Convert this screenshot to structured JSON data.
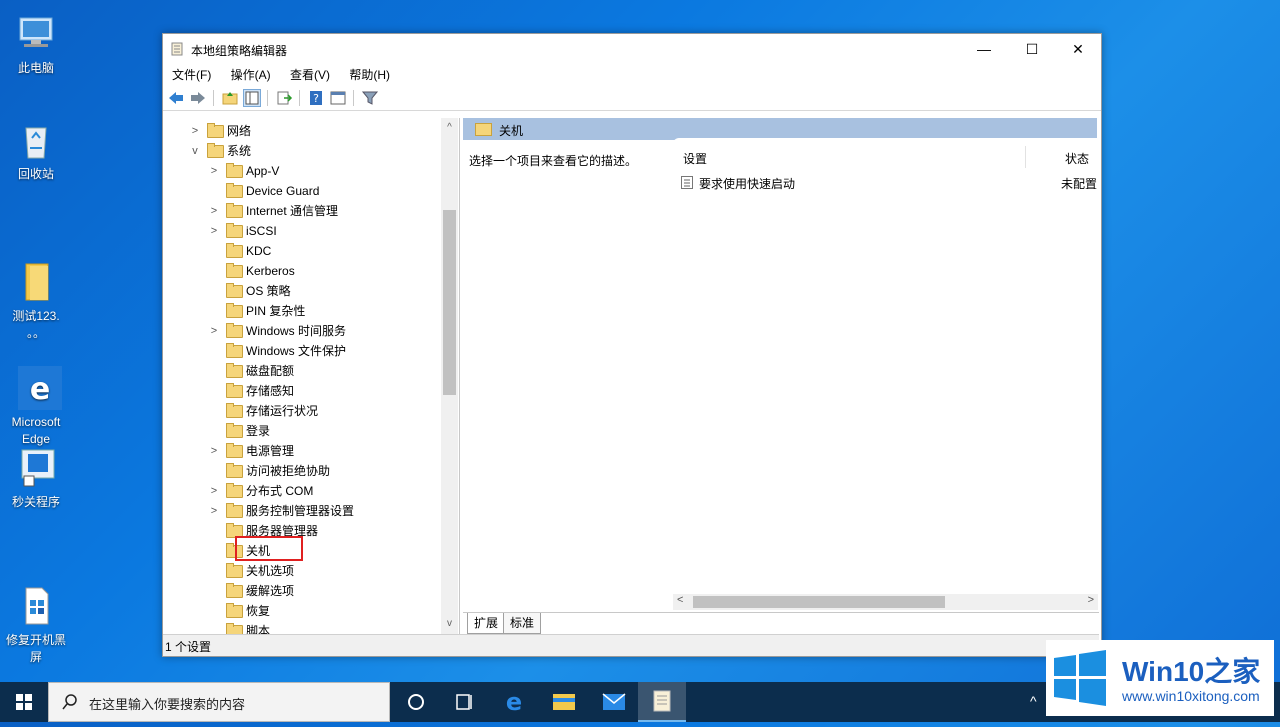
{
  "desktop": {
    "icons": [
      {
        "label": "此电脑"
      },
      {
        "label": "回收站"
      },
      {
        "label": "测试123.\n。。"
      },
      {
        "label": "Microsoft\nEdge"
      },
      {
        "label": "秒关程序"
      },
      {
        "label": "修复开机黑\n屏"
      }
    ]
  },
  "window": {
    "title": "本地组策略编辑器",
    "controls": {
      "minimize": "—",
      "maximize": "☐",
      "close": "✕"
    },
    "menu": [
      "文件(F)",
      "操作(A)",
      "查看(V)",
      "帮助(H)"
    ],
    "toolbar_icons": [
      "back-icon",
      "forward-icon",
      "up-folder-icon",
      "show-tree-icon",
      "export-icon",
      "help-icon",
      "properties-icon",
      "filter-icon"
    ]
  },
  "tree": {
    "items": [
      {
        "label": "网络",
        "expander": ">",
        "level": 0
      },
      {
        "label": "系统",
        "expander": "v",
        "level": 0
      },
      {
        "label": "App-V",
        "expander": ">",
        "level": 1
      },
      {
        "label": "Device Guard",
        "expander": "",
        "level": 1
      },
      {
        "label": "Internet 通信管理",
        "expander": ">",
        "level": 1
      },
      {
        "label": "iSCSI",
        "expander": ">",
        "level": 1
      },
      {
        "label": "KDC",
        "expander": "",
        "level": 1
      },
      {
        "label": "Kerberos",
        "expander": "",
        "level": 1
      },
      {
        "label": "OS 策略",
        "expander": "",
        "level": 1
      },
      {
        "label": "PIN 复杂性",
        "expander": "",
        "level": 1
      },
      {
        "label": "Windows 时间服务",
        "expander": ">",
        "level": 1
      },
      {
        "label": "Windows 文件保护",
        "expander": "",
        "level": 1
      },
      {
        "label": "磁盘配额",
        "expander": "",
        "level": 1
      },
      {
        "label": "存储感知",
        "expander": "",
        "level": 1
      },
      {
        "label": "存储运行状况",
        "expander": "",
        "level": 1
      },
      {
        "label": "登录",
        "expander": "",
        "level": 1
      },
      {
        "label": "电源管理",
        "expander": ">",
        "level": 1
      },
      {
        "label": "访问被拒绝协助",
        "expander": "",
        "level": 1
      },
      {
        "label": "分布式 COM",
        "expander": ">",
        "level": 1
      },
      {
        "label": "服务控制管理器设置",
        "expander": ">",
        "level": 1
      },
      {
        "label": "服务器管理器",
        "expander": "",
        "level": 1
      },
      {
        "label": "关机",
        "expander": "",
        "level": 1,
        "selected": true
      },
      {
        "label": "关机选项",
        "expander": "",
        "level": 1
      },
      {
        "label": "缓解选项",
        "expander": "",
        "level": 1
      },
      {
        "label": "恢复",
        "expander": "",
        "level": 1
      },
      {
        "label": "脚本",
        "expander": "",
        "level": 1
      }
    ],
    "scroll_up": "^",
    "scroll_down": "v"
  },
  "details": {
    "header": "关机",
    "description": "选择一个项目来查看它的描述。",
    "columns": [
      "设置",
      "状态"
    ],
    "rows": [
      {
        "name": "要求使用快速启动",
        "state": "未配置"
      }
    ],
    "hscroll_left": "<",
    "hscroll_right": ">",
    "tabs": [
      "扩展",
      "标准"
    ]
  },
  "statusbar": {
    "text": "1 个设置"
  },
  "taskbar": {
    "search_placeholder": "在这里输入你要搜索的内容",
    "apps": [
      "cortana-icon",
      "task-view-icon",
      "edge-icon",
      "file-explorer-icon",
      "mail-icon",
      "gpedit-icon"
    ],
    "tray_arrow": "^"
  },
  "watermark": {
    "title": "Win10之家",
    "url": "www.win10xitong.com"
  },
  "colors": {
    "accent": "#0078d7",
    "tree_header": "#a8c1e0",
    "highlight": "#e02020",
    "taskbar": "#0c2d4d"
  }
}
